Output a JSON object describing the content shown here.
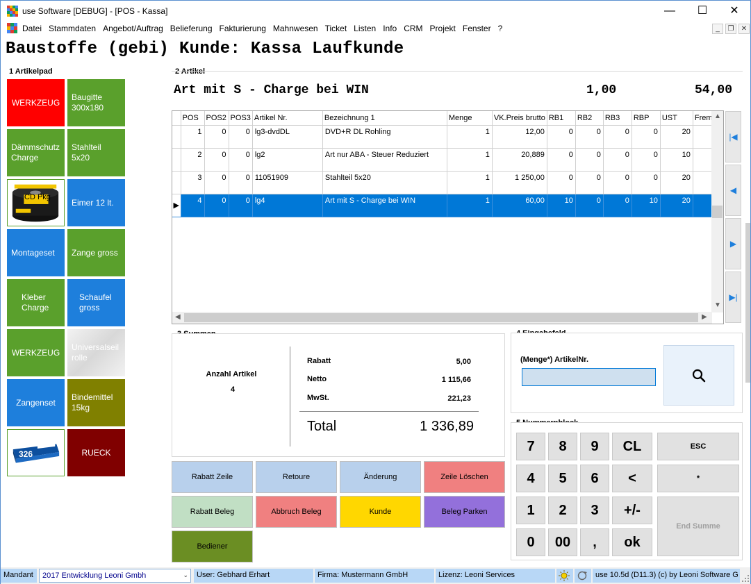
{
  "window": {
    "title": "use Software [DEBUG] - [POS - Kassa]",
    "min_glyph": "—",
    "max_glyph": "☐",
    "close_glyph": "✕",
    "mdi_min": "_",
    "mdi_restore": "❐",
    "mdi_close": "✕"
  },
  "menu": [
    "Datei",
    "Stammdaten",
    "Angebot/Auftrag",
    "Belieferung",
    "Fakturierung",
    "Mahnwesen",
    "Ticket",
    "Listen",
    "Info",
    "CRM",
    "Projekt",
    "Fenster",
    "?"
  ],
  "heading": "Baustoffe (gebi) Kunde: Kassa Laufkunde",
  "groups": {
    "artikelpad": "1 Artikelpad",
    "artikel": "2 Artikel",
    "summen": "3 Summen",
    "eingabefeld": "4 Eingabefeld",
    "nummernblock": "5 Nummernblock"
  },
  "tiles": [
    {
      "label": "WERKZEUG"
    },
    {
      "label": "Baugitte 300x180"
    },
    {
      "label": "Dämmschutz Charge"
    },
    {
      "label": "Stahlteil 5x20"
    },
    {
      "label": "CD Pkg"
    },
    {
      "label": "Eimer 12 lt."
    },
    {
      "label": "Montageset"
    },
    {
      "label": "Zange gross"
    },
    {
      "label": "Kleber Charge"
    },
    {
      "label": "Schaufel gross"
    },
    {
      "label": "WERKZEUG"
    },
    {
      "label": "Universalseilrolle"
    },
    {
      "label": "Zangenset"
    },
    {
      "label": "Bindemittel 15kg"
    },
    {
      "label": "326"
    },
    {
      "label": "RUECK"
    }
  ],
  "current_article": {
    "name": "Art mit S - Charge bei WIN",
    "menge": "1,00",
    "preis": "54,00"
  },
  "grid": {
    "columns": [
      "POS",
      "POS2",
      "POS3",
      "Artikel Nr.",
      "Bezeichnung 1",
      "Menge",
      "VK.Preis brutto",
      "RB1",
      "RB2",
      "RB3",
      "RBP",
      "UST",
      "Frem"
    ],
    "rows": [
      {
        "cells": [
          "1",
          "0",
          "0",
          "lg3-dvdDL",
          "DVD+R DL Rohling",
          "1",
          "12,00",
          "0",
          "0",
          "0",
          "0",
          "20",
          ""
        ]
      },
      {
        "cells": [
          "2",
          "0",
          "0",
          "lg2",
          "Art nur ABA - Steuer Reduziert",
          "1",
          "20,889",
          "0",
          "0",
          "0",
          "0",
          "10",
          ""
        ]
      },
      {
        "cells": [
          "3",
          "0",
          "0",
          "11051909",
          "Stahlteil 5x20",
          "1",
          "1 250,00",
          "0",
          "0",
          "0",
          "0",
          "20",
          ""
        ]
      },
      {
        "cells": [
          "4",
          "0",
          "0",
          "lg4",
          "Art mit S - Charge bei WIN",
          "1",
          "60,00",
          "10",
          "0",
          "0",
          "10",
          "20",
          ""
        ]
      }
    ],
    "selected_row": 4
  },
  "nav_buttons": {
    "first": "|◀",
    "prev": "◀",
    "next": "▶",
    "last": "▶|"
  },
  "summen": {
    "anzahl_label": "Anzahl Artikel",
    "anzahl_value": "4",
    "rabatt_label": "Rabatt",
    "rabatt_value": "5,00",
    "netto_label": "Netto",
    "netto_value": "1 115,66",
    "mwst_label": "MwSt.",
    "mwst_value": "221,23",
    "total_label": "Total",
    "total_value": "1 336,89"
  },
  "actions": {
    "rabatt_zeile": "Rabatt Zeile",
    "retoure": "Retoure",
    "aenderung": "Änderung",
    "zeile_loeschen": "Zeile Löschen",
    "rabatt_beleg": "Rabatt Beleg",
    "abbruch_beleg": "Abbruch Beleg",
    "kunde": "Kunde",
    "beleg_parken": "Beleg Parken",
    "bediener": "Bediener"
  },
  "eingabe": {
    "label": "(Menge*)  ArtikelNr.",
    "value": ""
  },
  "numpad": {
    "k7": "7",
    "k8": "8",
    "k9": "9",
    "cl": "CL",
    "k4": "4",
    "k5": "5",
    "k6": "6",
    "back": "<",
    "k1": "1",
    "k2": "2",
    "k3": "3",
    "plusminus": "+/-",
    "k0": "0",
    "k00": "00",
    "comma": ",",
    "ok": "ok",
    "esc": "ESC",
    "star": "*",
    "endsumme": "End Summe"
  },
  "status": {
    "mandant_label": "Mandant",
    "mandant_value": "2017  Entwicklung Leoni Gmbh",
    "user": "User: Gebhard Erhart",
    "firma": "Firma: Mustermann GmbH",
    "lizenz": "Lizenz: Leoni Services",
    "version": "use  10.5d (D11.3) (c) by Leoni Software G"
  },
  "colors": {
    "accent": "#0078d7",
    "status_bg": "#b8d7f6"
  }
}
